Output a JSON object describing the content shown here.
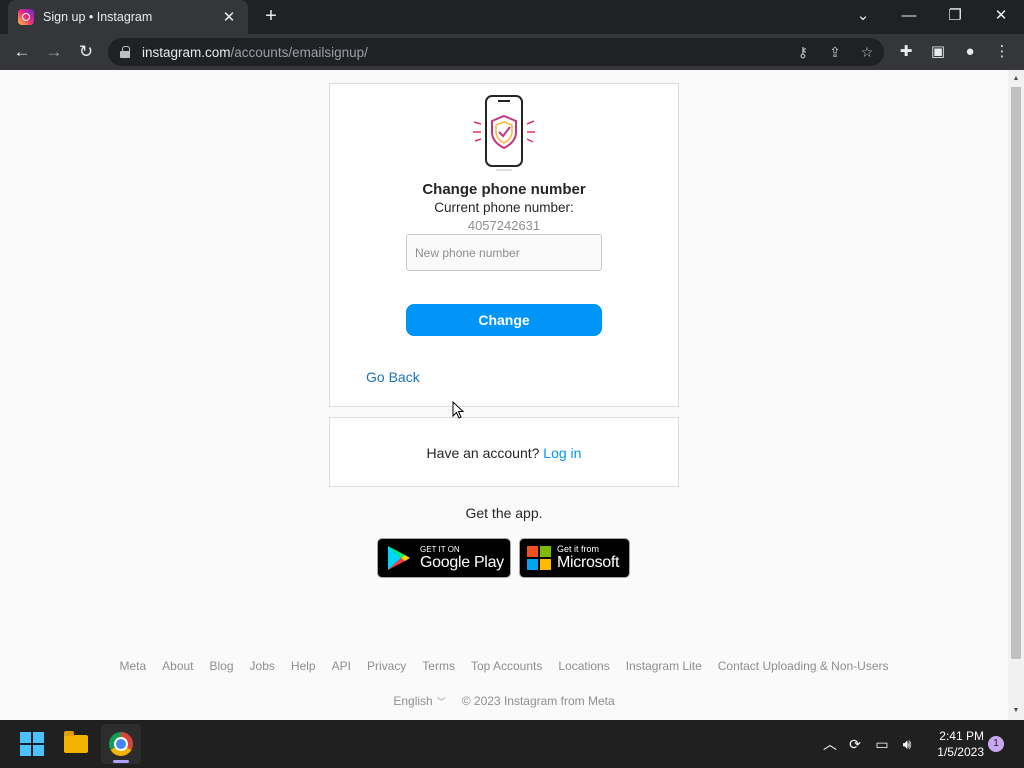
{
  "browser": {
    "tab_title": "Sign up • Instagram",
    "tab_close": "✕",
    "new_tab": "+",
    "url_host": "instagram.com",
    "url_path": "/accounts/emailsignup/",
    "icons": [
      "back-icon",
      "forward-icon",
      "reload-icon",
      "key-icon",
      "share-icon",
      "star-icon",
      "extensions-icon",
      "side-panel-icon",
      "profile-icon",
      "menu-icon"
    ]
  },
  "card": {
    "title": "Change phone number",
    "subtitle": "Current phone number:",
    "current_number": "4057242631",
    "input_placeholder": "New phone number",
    "change_label": "Change",
    "go_back_label": "Go Back"
  },
  "login": {
    "prompt": "Have an account?",
    "link": "Log in"
  },
  "get_app": {
    "label": "Get the app.",
    "google_small": "GET IT ON",
    "google_big": "Google Play",
    "microsoft_small": "Get it from",
    "microsoft_big": "Microsoft"
  },
  "footer": {
    "links": [
      "Meta",
      "About",
      "Blog",
      "Jobs",
      "Help",
      "API",
      "Privacy",
      "Terms",
      "Top Accounts",
      "Locations",
      "Instagram Lite",
      "Contact Uploading & Non-Users"
    ],
    "language": "English",
    "copyright": "© 2023 Instagram from Meta"
  },
  "taskbar": {
    "time": "2:41 PM",
    "date": "1/5/2023",
    "notification_count": "1"
  },
  "colors": {
    "primary_button": "#0095f6",
    "link": "#0095f6",
    "go_back": "#1b74b8"
  }
}
